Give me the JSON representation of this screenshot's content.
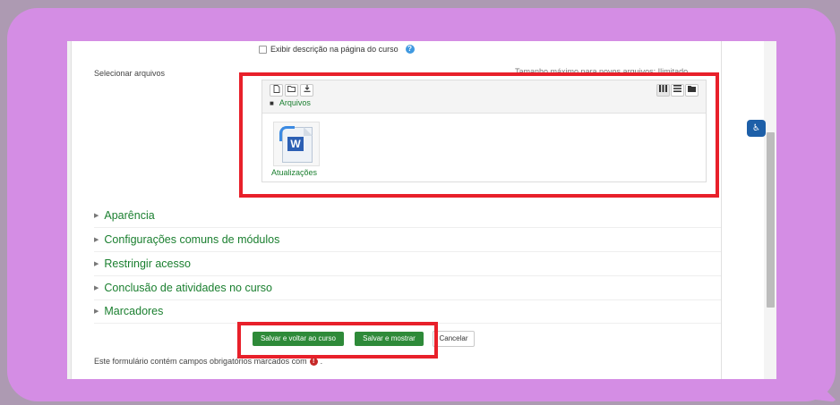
{
  "display_option": {
    "label": "Exibir descrição na página do curso",
    "checked": false
  },
  "file_select": {
    "label": "Selecionar arquivos",
    "hint": "Tamanho máximo para novos arquivos: Ilimitado",
    "path": "Arquivos",
    "files": [
      {
        "name": "Atualizações",
        "type": "word-document"
      }
    ]
  },
  "toolbar": {
    "add_file_icon": "add-file-icon",
    "new_folder_icon": "new-folder-icon",
    "download_icon": "download-icon",
    "view_icons": [
      "grid-view-icon",
      "list-view-icon",
      "folder-view-icon"
    ]
  },
  "sections": [
    {
      "label": "Aparência"
    },
    {
      "label": "Configurações comuns de módulos"
    },
    {
      "label": "Restringir acesso"
    },
    {
      "label": "Conclusão de atividades no curso"
    },
    {
      "label": "Marcadores"
    }
  ],
  "buttons": {
    "save_return": "Salvar e voltar ao curso",
    "save_show": "Salvar e mostrar",
    "cancel": "Cancelar"
  },
  "footer": {
    "note": "Este formulário contém campos obrigatórios marcados com",
    "suffix": "."
  },
  "colors": {
    "accent_green": "#2e8a39",
    "highlight_red": "#e8202a",
    "bubble": "#d48de4"
  }
}
